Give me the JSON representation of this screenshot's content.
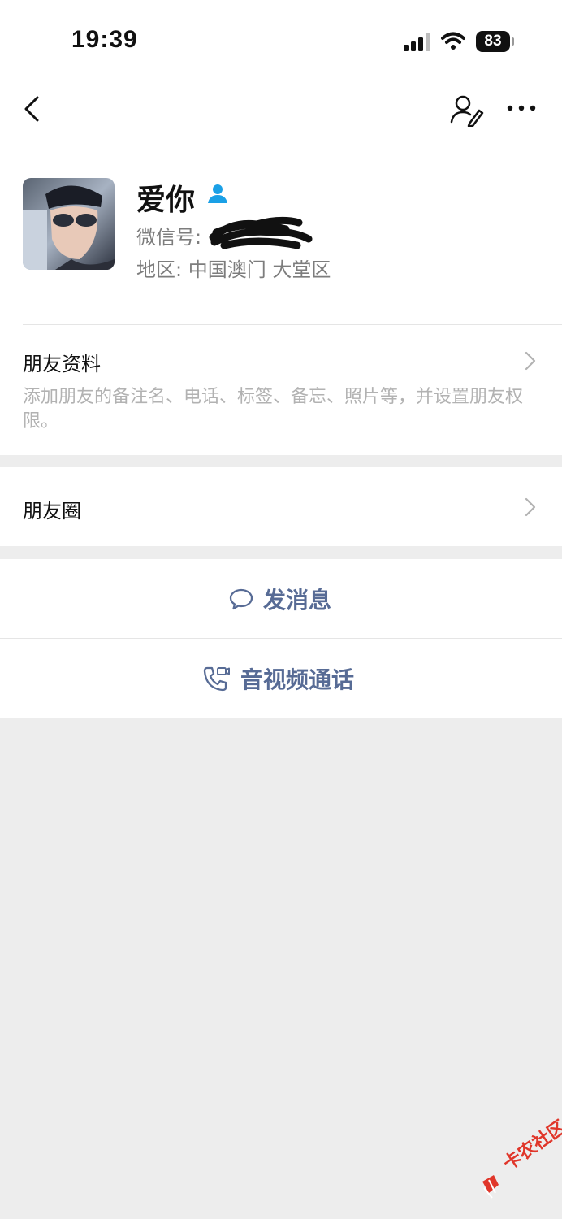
{
  "status_bar": {
    "time": "19:39",
    "battery": "83"
  },
  "profile": {
    "name": "爱你",
    "wechat_id_label": "微信号:",
    "wechat_id_value": "",
    "region": "地区: 中国澳门 大堂区"
  },
  "friend_info": {
    "title": "朋友资料",
    "description": "添加朋友的备注名、电话、标签、备忘、照片等，并设置朋友权限。"
  },
  "moments": {
    "label": "朋友圈"
  },
  "actions": {
    "message": "发消息",
    "call": "音视频通话"
  },
  "watermark": "卡农社区",
  "colors": {
    "accent": "#576b95",
    "secondary_text": "#7d7d7d",
    "hint_text": "#b2b2b2",
    "background": "#ededed",
    "badge": "#1aa0e6"
  },
  "icons": [
    "back-chevron-icon",
    "edit-profile-icon",
    "more-icon",
    "friend-badge-icon",
    "chevron-right-icon",
    "chat-bubble-icon",
    "video-call-icon"
  ]
}
